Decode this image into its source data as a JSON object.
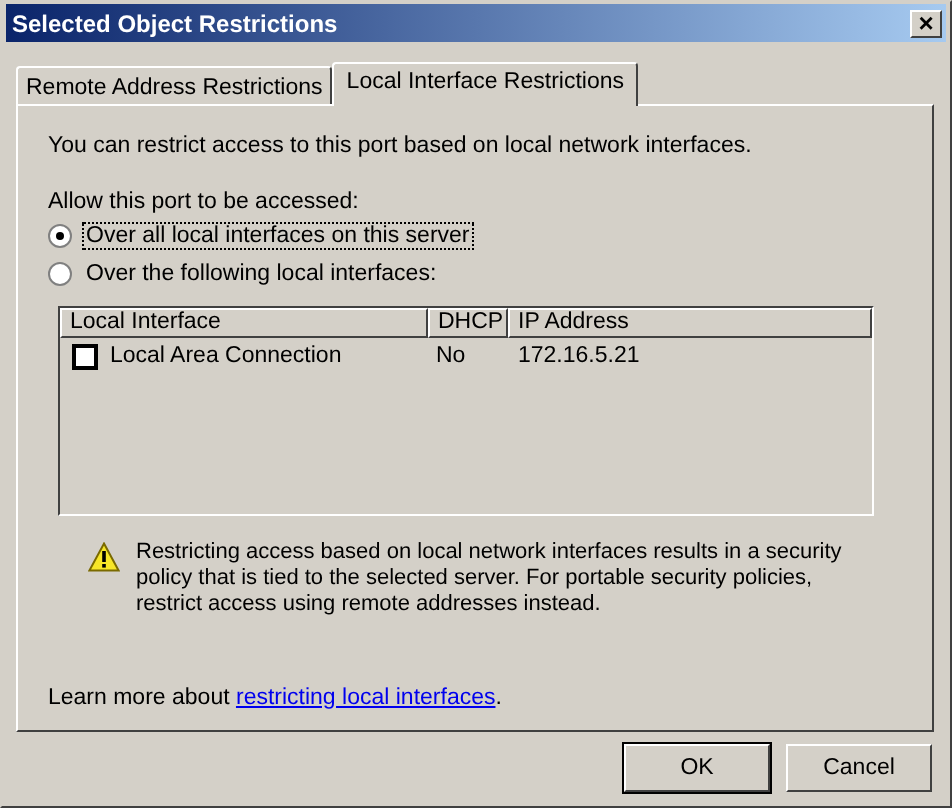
{
  "window": {
    "title": "Selected Object Restrictions",
    "close": "×"
  },
  "tabs": [
    {
      "label": "Remote Address Restrictions",
      "selected": false
    },
    {
      "label": "Local Interface Restrictions",
      "selected": true
    }
  ],
  "intro": "You can restrict access to this port based on local network interfaces.",
  "access_label": "Allow this port to be accessed:",
  "options": [
    {
      "label": "Over all local interfaces on this server",
      "selected": true
    },
    {
      "label": "Over the following local interfaces:",
      "selected": false
    }
  ],
  "table": {
    "columns": [
      "Local Interface",
      "DHCP",
      "IP Address"
    ],
    "rows": [
      {
        "name": "Local Area Connection",
        "checked": false,
        "dhcp": "No",
        "ip": "172.16.5.21"
      }
    ]
  },
  "warning": "Restricting access based on local network interfaces results in a security policy that is tied to the selected server. For portable security policies, restrict access using remote addresses instead.",
  "learn_more": {
    "prefix": "Learn more about ",
    "link": "restricting local interfaces",
    "suffix": "."
  },
  "buttons": [
    "OK",
    "Cancel"
  ]
}
